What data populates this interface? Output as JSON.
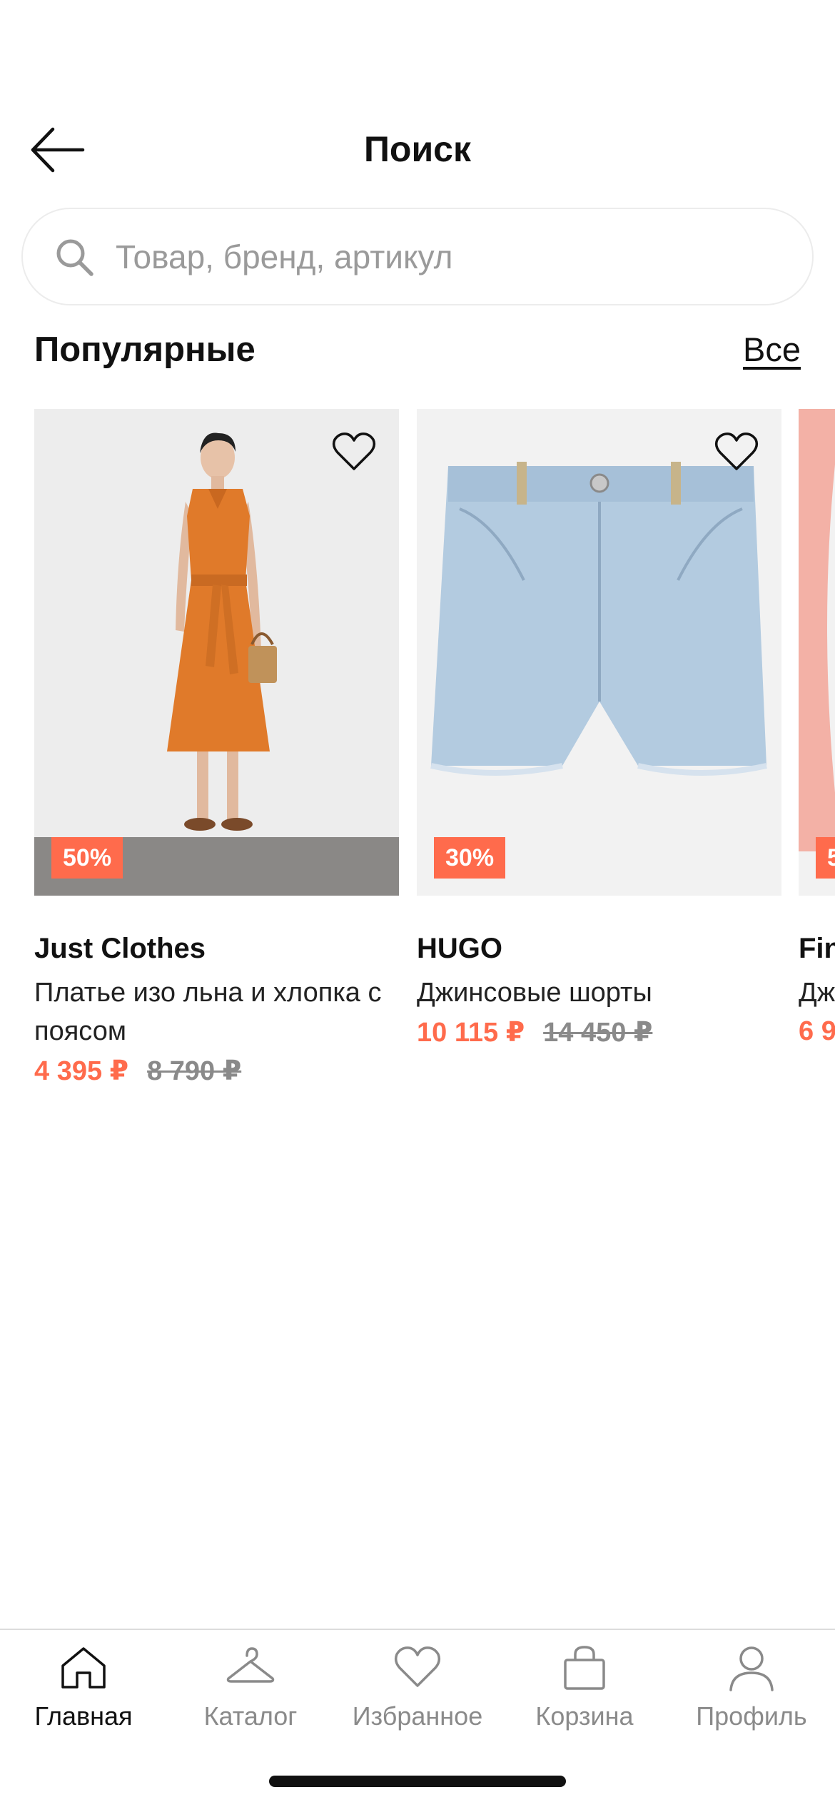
{
  "header": {
    "title": "Поиск"
  },
  "search": {
    "placeholder": "Товар, бренд, артикул",
    "value": ""
  },
  "section": {
    "title": "Популярные",
    "all_label": "Все"
  },
  "products": [
    {
      "brand": "Just Clothes",
      "name": "Платье изо льна и хлопка с поясом",
      "discount": "50%",
      "price": "4 395 ₽",
      "old_price": "8 790 ₽"
    },
    {
      "brand": "HUGO",
      "name": "Джинсовые шорты",
      "discount": "30%",
      "price": "10 115 ₽",
      "old_price": "14 450 ₽"
    },
    {
      "brand": "Fin",
      "name": "Дж",
      "discount": "5",
      "price": "6 9",
      "old_price": ""
    }
  ],
  "tabs": [
    {
      "label": "Главная",
      "icon": "home-icon",
      "active": true
    },
    {
      "label": "Каталог",
      "icon": "hanger-icon",
      "active": false
    },
    {
      "label": "Избранное",
      "icon": "heart-icon",
      "active": false
    },
    {
      "label": "Корзина",
      "icon": "bag-icon",
      "active": false
    },
    {
      "label": "Профиль",
      "icon": "profile-icon",
      "active": false
    }
  ],
  "colors": {
    "accent": "#ff6b4c",
    "muted": "#8a8a8a",
    "text": "#111111"
  }
}
